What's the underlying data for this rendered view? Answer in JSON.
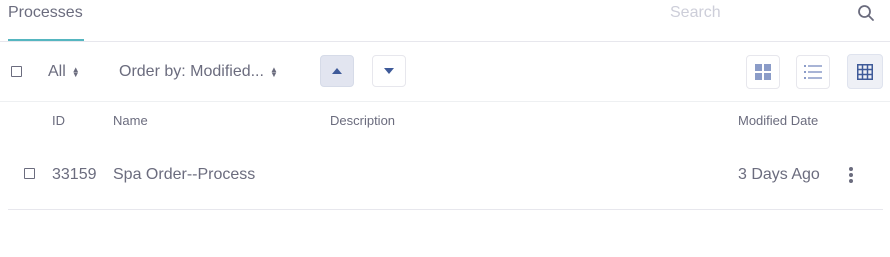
{
  "header": {
    "tab_label": "Processes",
    "search_placeholder": "Search"
  },
  "toolbar": {
    "filter_label": "All",
    "order_by_label": "Order by: Modified...",
    "sort_up_icon": "caret-up-icon",
    "sort_down_icon": "caret-down-icon",
    "view_modes": [
      "cards-view-icon",
      "list-view-icon",
      "table-view-icon"
    ],
    "active_view": "table"
  },
  "table": {
    "columns": [
      "ID",
      "Name",
      "Description",
      "Modified Date"
    ],
    "rows": [
      {
        "id": "33159",
        "name": "Spa Order--Process",
        "description": "",
        "modified": "3 Days Ago"
      }
    ]
  },
  "colors": {
    "accent_tab": "#55b6c0",
    "text": "#6b6c7e",
    "active_button_bg": "#e2e5f0",
    "icon_blue": "#3e5a99"
  }
}
